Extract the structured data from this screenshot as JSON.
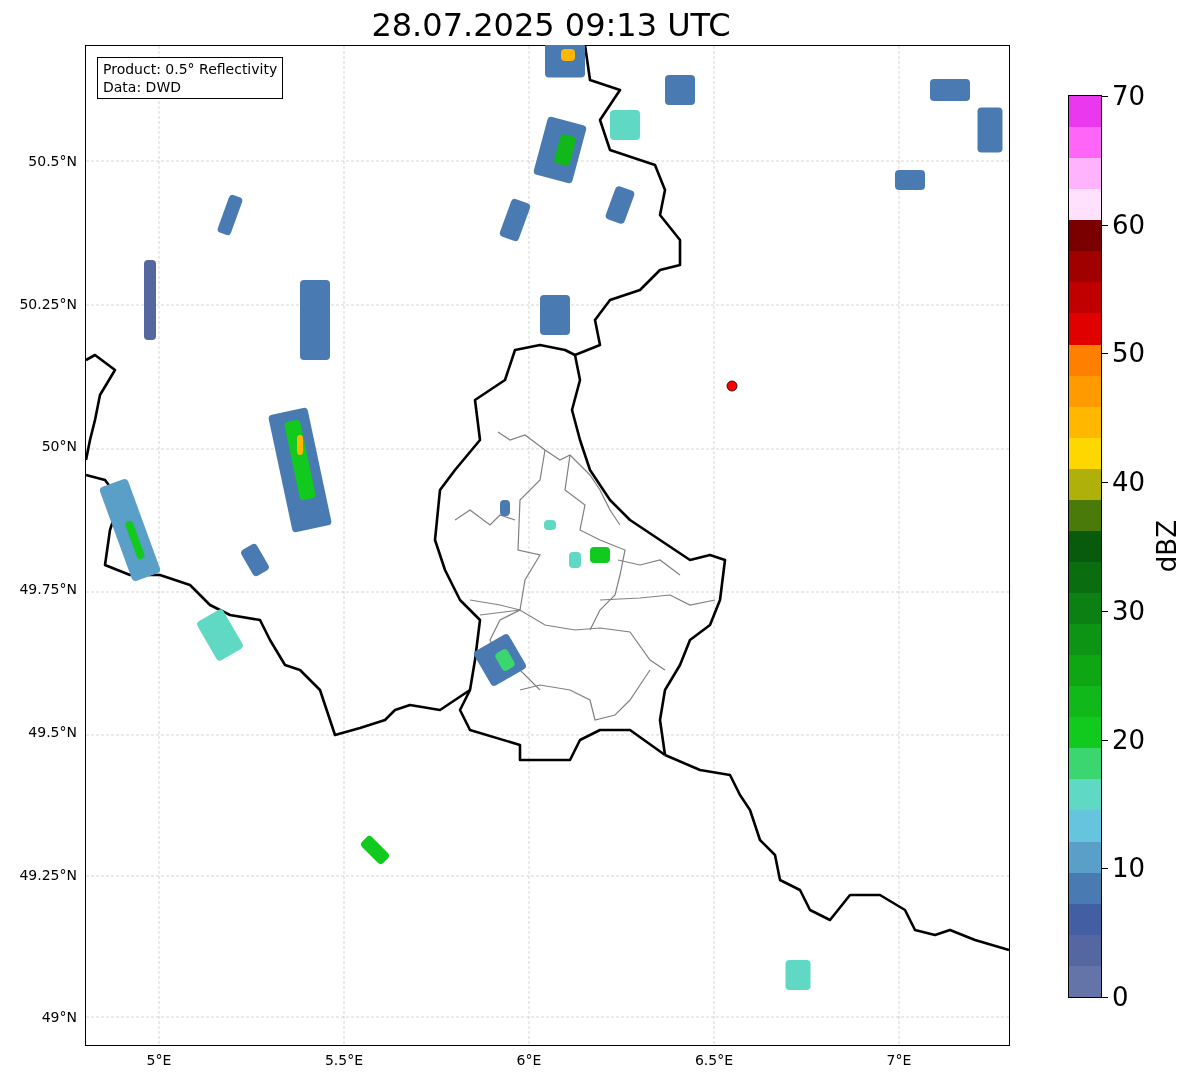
{
  "title": "28.07.2025 09:13 UTC",
  "info_box": [
    "Product: 0.5° Reflectivity",
    "Data: DWD"
  ],
  "y_ticks": [
    "50.5°N",
    "50.25°N",
    "50°N",
    "49.75°N",
    "49.5°N",
    "49.25°N",
    "49°N"
  ],
  "x_ticks": [
    "5°E",
    "5.5°E",
    "6°E",
    "6.5°E",
    "7°E"
  ],
  "colorbar": {
    "label": "dBZ",
    "ticks": [
      "70",
      "60",
      "50",
      "40",
      "30",
      "20",
      "10",
      "0"
    ],
    "segments": [
      {
        "color": "#ea38ee"
      },
      {
        "color": "#ff66f7"
      },
      {
        "color": "#ffb3fc"
      },
      {
        "color": "#ffe0fd"
      },
      {
        "color": "#7a0000"
      },
      {
        "color": "#a00000"
      },
      {
        "color": "#c00000"
      },
      {
        "color": "#e00000"
      },
      {
        "color": "#ff7f00"
      },
      {
        "color": "#ff9a00"
      },
      {
        "color": "#ffb700"
      },
      {
        "color": "#ffd700"
      },
      {
        "color": "#b0b00a"
      },
      {
        "color": "#4a7a0a"
      },
      {
        "color": "#085a0c"
      },
      {
        "color": "#0a6e10"
      },
      {
        "color": "#0c8012"
      },
      {
        "color": "#0e9414"
      },
      {
        "color": "#0fa614"
      },
      {
        "color": "#11b81a"
      },
      {
        "color": "#12c91e"
      },
      {
        "color": "#3cd670"
      },
      {
        "color": "#5fd8c4"
      },
      {
        "color": "#66c4dc"
      },
      {
        "color": "#5a9fc8"
      },
      {
        "color": "#4a7ab2"
      },
      {
        "color": "#435fa3"
      },
      {
        "color": "#5467a0"
      },
      {
        "color": "#6474a8"
      }
    ]
  }
}
